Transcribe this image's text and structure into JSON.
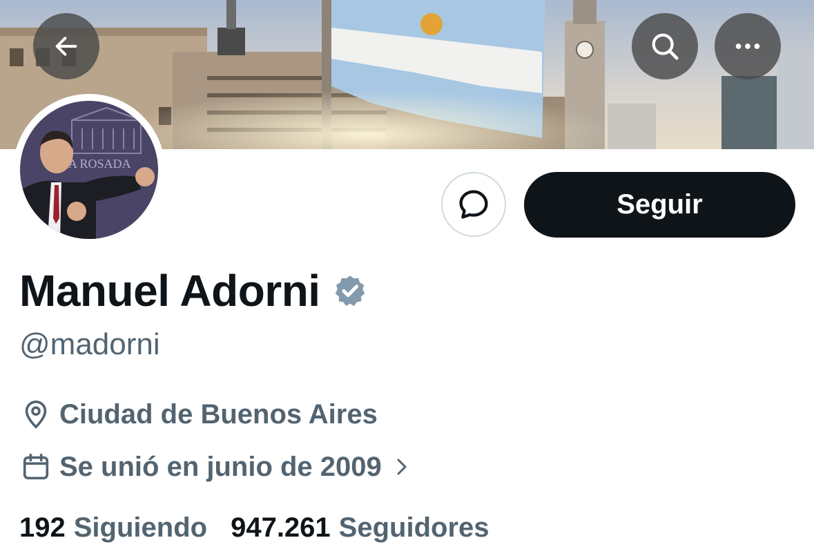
{
  "colors": {
    "primary_text": "#0f1419",
    "secondary_text": "#536471",
    "verified_badge": "#829aab",
    "follow_button_bg": "#0f1419",
    "follow_button_text": "#ffffff"
  },
  "header": {
    "back_icon": "arrow-left-icon",
    "search_icon": "search-icon",
    "more_icon": "more-horizontal-icon"
  },
  "banner": {
    "avatar_sign_text": "A ROSADA"
  },
  "actions": {
    "message_icon": "chat-bubble-icon",
    "follow_label": "Seguir"
  },
  "profile": {
    "name": "Manuel Adorni",
    "verified_icon": "verified-badge-icon",
    "handle": "@madorni",
    "location": "Ciudad de Buenos Aires",
    "location_icon": "location-pin-icon",
    "joined": "Se unió en junio de 2009",
    "joined_icon": "calendar-icon",
    "joined_chevron_icon": "chevron-right-icon"
  },
  "stats": {
    "following_count": "192",
    "following_label": "Siguiendo",
    "followers_count": "947.261",
    "followers_label": "Seguidores"
  }
}
